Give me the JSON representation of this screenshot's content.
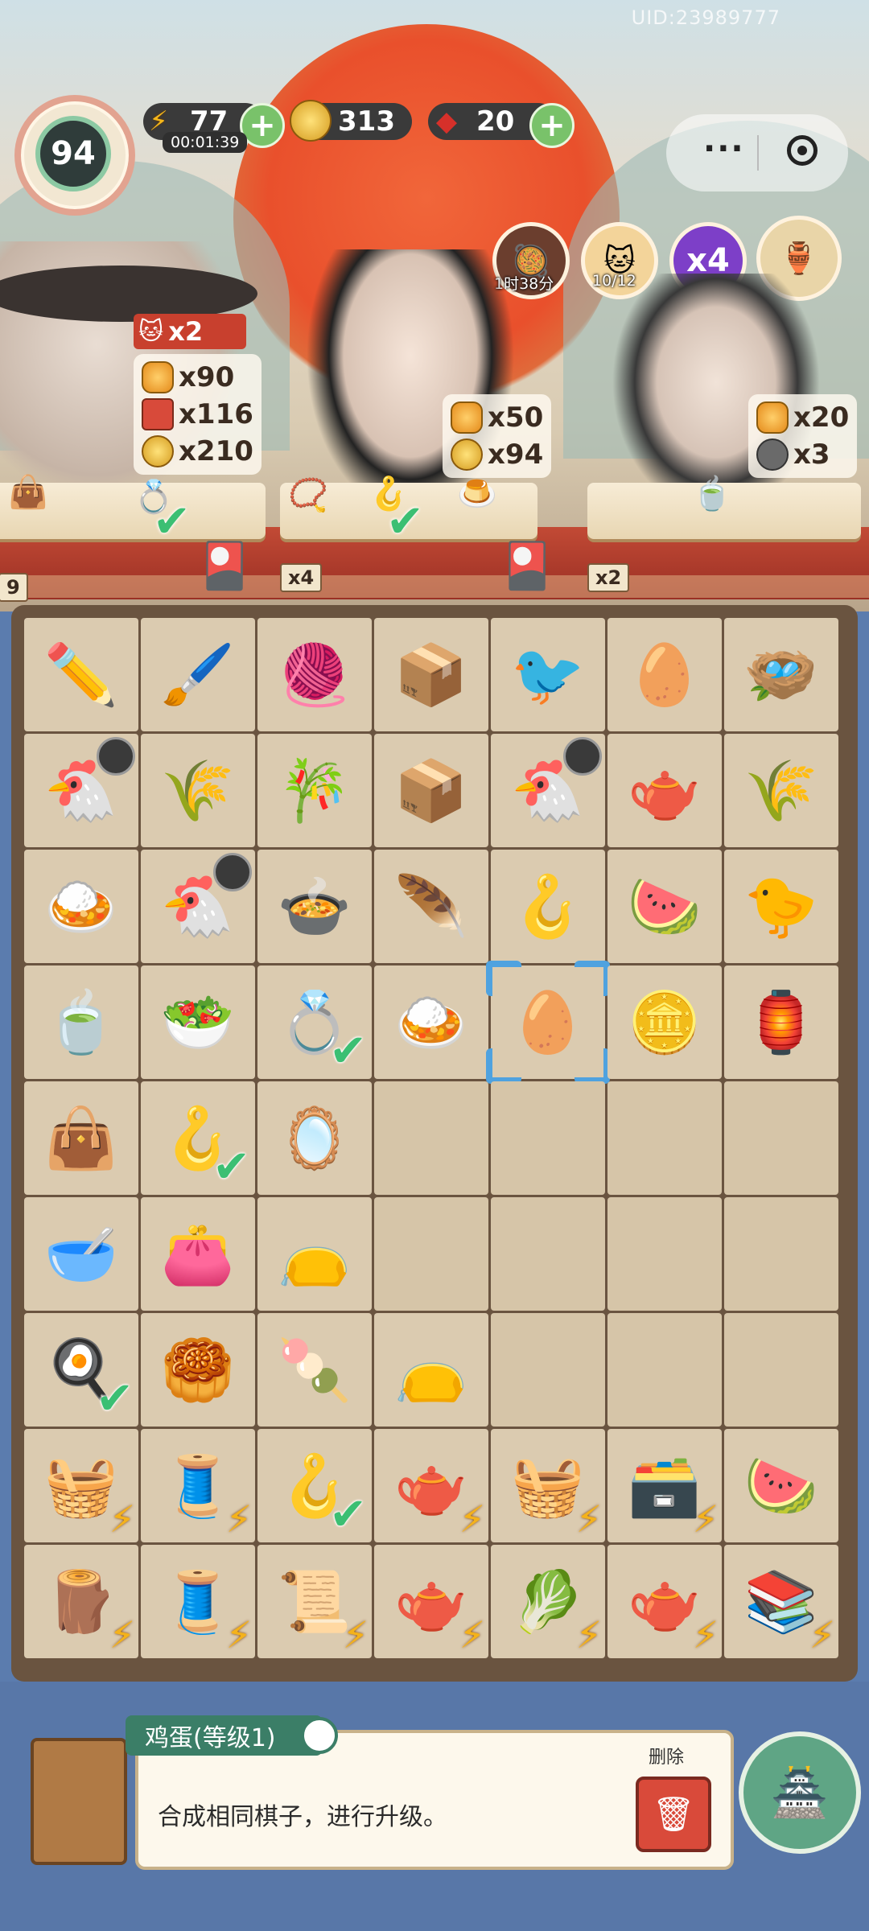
{
  "uid": "UID:23989777",
  "player": {
    "level": "94"
  },
  "currency": {
    "energy": {
      "value": "77",
      "timer": "00:01:39",
      "icon": "lightning-icon"
    },
    "coins": {
      "value": "313",
      "icon": "coin-icon"
    },
    "gems": {
      "value": "20",
      "icon": "red-gem-icon"
    }
  },
  "top_icons": {
    "wok": {
      "label": "1时38分"
    },
    "cat": {
      "label": "10/12"
    },
    "multiplier": {
      "label": "x4"
    }
  },
  "customers": [
    {
      "bonus": "x2",
      "rewards": [
        "x90",
        "x116",
        "x210"
      ],
      "tag": "9"
    },
    {
      "rewards": [
        "x50",
        "x94"
      ],
      "tag": "x4"
    },
    {
      "rewards": [
        "x20",
        "x3"
      ],
      "tag": "x2"
    }
  ],
  "board": {
    "cells": [
      {
        "icon": "✏️",
        "name": "drafting-tools"
      },
      {
        "icon": "🖌️",
        "name": "brush-and-ruler"
      },
      {
        "icon": "🧶",
        "name": "silk-cocoons"
      },
      {
        "icon": "📦",
        "name": "wooden-box"
      },
      {
        "icon": "🐦",
        "name": "golden-bird"
      },
      {
        "icon": "🥚",
        "name": "white-eggs-nest"
      },
      {
        "icon": "🪺",
        "name": "empty-nest"
      },
      {
        "icon": "🐔",
        "name": "chicken-coop",
        "timer": true
      },
      {
        "icon": "🌾",
        "name": "grain-husks"
      },
      {
        "icon": "🎋",
        "name": "bamboo-shoots"
      },
      {
        "icon": "📦",
        "name": "wooden-box-open"
      },
      {
        "icon": "🐔",
        "name": "chicken-coop",
        "timer": true
      },
      {
        "icon": "🫖",
        "name": "tea-jar"
      },
      {
        "icon": "🌾",
        "name": "wheat-bundle"
      },
      {
        "icon": "🍛",
        "name": "egg-fried-rice"
      },
      {
        "icon": "🐔",
        "name": "chicken-coop",
        "timer": true
      },
      {
        "icon": "🍲",
        "name": "chicken-soup"
      },
      {
        "icon": "🪶",
        "name": "blue-feather"
      },
      {
        "icon": "🪝",
        "name": "jade-pendant"
      },
      {
        "icon": "🍉",
        "name": "fruit-platter"
      },
      {
        "icon": "🐤",
        "name": "yellow-bird"
      },
      {
        "icon": "🍵",
        "name": "tea-cup"
      },
      {
        "icon": "🥗",
        "name": "pea-rice-bowl"
      },
      {
        "icon": "💍",
        "name": "gold-ring",
        "check": true
      },
      {
        "icon": "🍛",
        "name": "egg-fried-rice"
      },
      {
        "icon": "🥚",
        "name": "egg",
        "selected": true
      },
      {
        "icon": "🪙",
        "name": "gold-coins"
      },
      {
        "icon": "🏮",
        "name": "lantern"
      },
      {
        "icon": "👜",
        "name": "purple-purse"
      },
      {
        "icon": "🪝",
        "name": "jade-pendant",
        "check": true
      },
      {
        "icon": "🪞",
        "name": "hand-mirror"
      },
      {
        "empty": true
      },
      {
        "empty": true
      },
      {
        "empty": true
      },
      {
        "empty": true
      },
      {
        "icon": "🥣",
        "name": "congee-bowl"
      },
      {
        "icon": "👛",
        "name": "embroidered-pouch"
      },
      {
        "icon": "👝",
        "name": "purple-sachet"
      },
      {
        "empty": true
      },
      {
        "empty": true
      },
      {
        "empty": true
      },
      {
        "empty": true
      },
      {
        "icon": "🍳",
        "name": "fried-egg",
        "check": true
      },
      {
        "icon": "🥮",
        "name": "flower-pastry"
      },
      {
        "icon": "🍡",
        "name": "pink-pastry"
      },
      {
        "icon": "👝",
        "name": "lavender-sachet"
      },
      {
        "empty": true
      },
      {
        "empty": true
      },
      {
        "empty": true
      },
      {
        "icon": "🧺",
        "name": "flour-basket",
        "bolt": true
      },
      {
        "icon": "🧵",
        "name": "spinning-wheel",
        "bolt": true
      },
      {
        "icon": "🪝",
        "name": "jade-pendant",
        "check": true
      },
      {
        "icon": "🫖",
        "name": "teapot-set",
        "bolt": true
      },
      {
        "icon": "🧺",
        "name": "food-basket",
        "bolt": true
      },
      {
        "icon": "🗃️",
        "name": "jewelry-chest",
        "bolt": true
      },
      {
        "icon": "🍉",
        "name": "watermelon-slices"
      },
      {
        "icon": "🪵",
        "name": "wooden-ring-stand",
        "bolt": true
      },
      {
        "icon": "🧵",
        "name": "loom",
        "bolt": true
      },
      {
        "icon": "📜",
        "name": "paper-scroll-maker",
        "bolt": true
      },
      {
        "icon": "🫖",
        "name": "teapot-tray",
        "bolt": true
      },
      {
        "icon": "🥬",
        "name": "vegetable-basket",
        "bolt": true
      },
      {
        "icon": "🫖",
        "name": "blue-teapot",
        "bolt": true
      },
      {
        "icon": "📚",
        "name": "scroll-rack",
        "bolt": true
      }
    ]
  },
  "info_panel": {
    "title": "鸡蛋(等级1)",
    "description": "合成相同棋子，进行升级。",
    "delete_label": "删除"
  }
}
